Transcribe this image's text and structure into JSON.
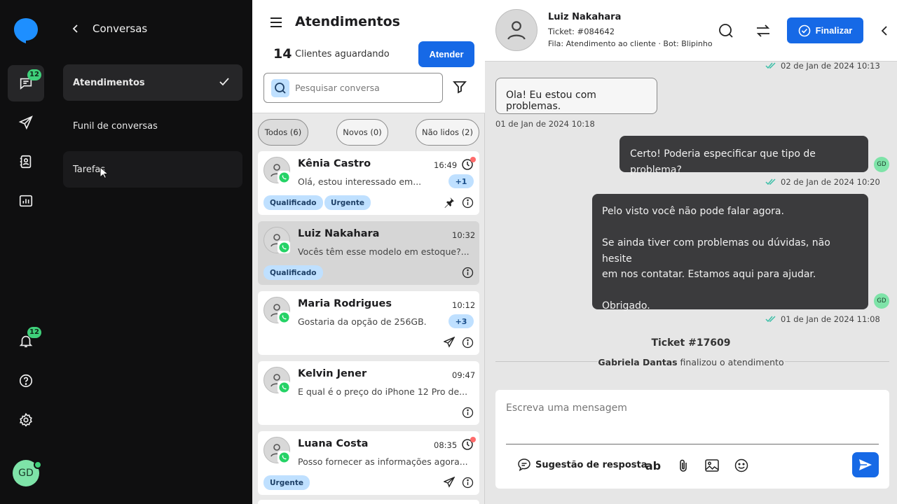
{
  "rail": {
    "chat_badge": "12",
    "bell_badge": "12",
    "avatar_initials": "GD"
  },
  "submenu": {
    "title": "Conversas",
    "items": [
      {
        "label": "Atendimentos",
        "active": true
      },
      {
        "label": "Funil de conversas",
        "active": false
      },
      {
        "label": "Tarefas",
        "active": false
      }
    ]
  },
  "list": {
    "title": "Atendimentos",
    "waiting_count": "14",
    "waiting_label": "Clientes aguardando",
    "attend_button": "Atender",
    "search_placeholder": "Pesquisar conversa",
    "chips": [
      "Todos (6)",
      "Novos (0)",
      "Não lidos (2)"
    ],
    "conversations": [
      {
        "name": "Kênia Castro",
        "time": "16:49",
        "message": "Olá, estou interessado em...",
        "unread": "+1",
        "tags": [
          "Qualificado",
          "Urgente"
        ]
      },
      {
        "name": "Luiz Nakahara",
        "time": "10:32",
        "message": "Vocês têm esse modelo em estoque?...",
        "unread": "",
        "tags": [
          "Qualificado"
        ]
      },
      {
        "name": "Maria Rodrigues",
        "time": "10:12",
        "message": "Gostaria da opção de 256GB.",
        "unread": "+3",
        "tags": []
      },
      {
        "name": "Kelvin Jener",
        "time": "09:47",
        "message": "E qual é o preço do iPhone 12 Pro de...",
        "unread": "",
        "tags": []
      },
      {
        "name": "Luana Costa",
        "time": "08:35",
        "message": "Posso fornecer as informações agora...",
        "unread": "",
        "tags": [
          "Urgente"
        ]
      }
    ]
  },
  "chat": {
    "contact_name": "Luiz Nakahara",
    "ticket": "Ticket: #084642",
    "queue": "Fila: Atendimento ao cliente · Bot:  Blipinho",
    "finish_button": "Finalizar",
    "top_meta": "02 de Jan de 2024 10:13",
    "messages": [
      {
        "dir": "in",
        "text": "Ola! Eu estou com problemas.",
        "meta": "01 de Jan de 2024 10:18"
      },
      {
        "dir": "out",
        "text": "Certo! Poderia especificar que tipo de problema?",
        "meta": "02 de Jan de 2024 10:20",
        "avatar": "GD"
      },
      {
        "dir": "out",
        "lines": [
          "Pelo visto você não pode falar agora.",
          "",
          "Se ainda tiver com problemas ou dúvidas, não hesite",
          "em nos contatar. Estamos aqui para ajudar.",
          "",
          "Obrigado."
        ],
        "meta": "01 de Jan de 2024 11:08",
        "avatar": "GD"
      }
    ],
    "ticket_closed": {
      "title": "Ticket #17609",
      "agent": "Gabriela Dantas",
      "text": " finalizou o atendimento"
    },
    "composer_placeholder": "Escreva uma mensagem",
    "suggestion_label": "Sugestão de resposta",
    "text_tool": "ab"
  }
}
